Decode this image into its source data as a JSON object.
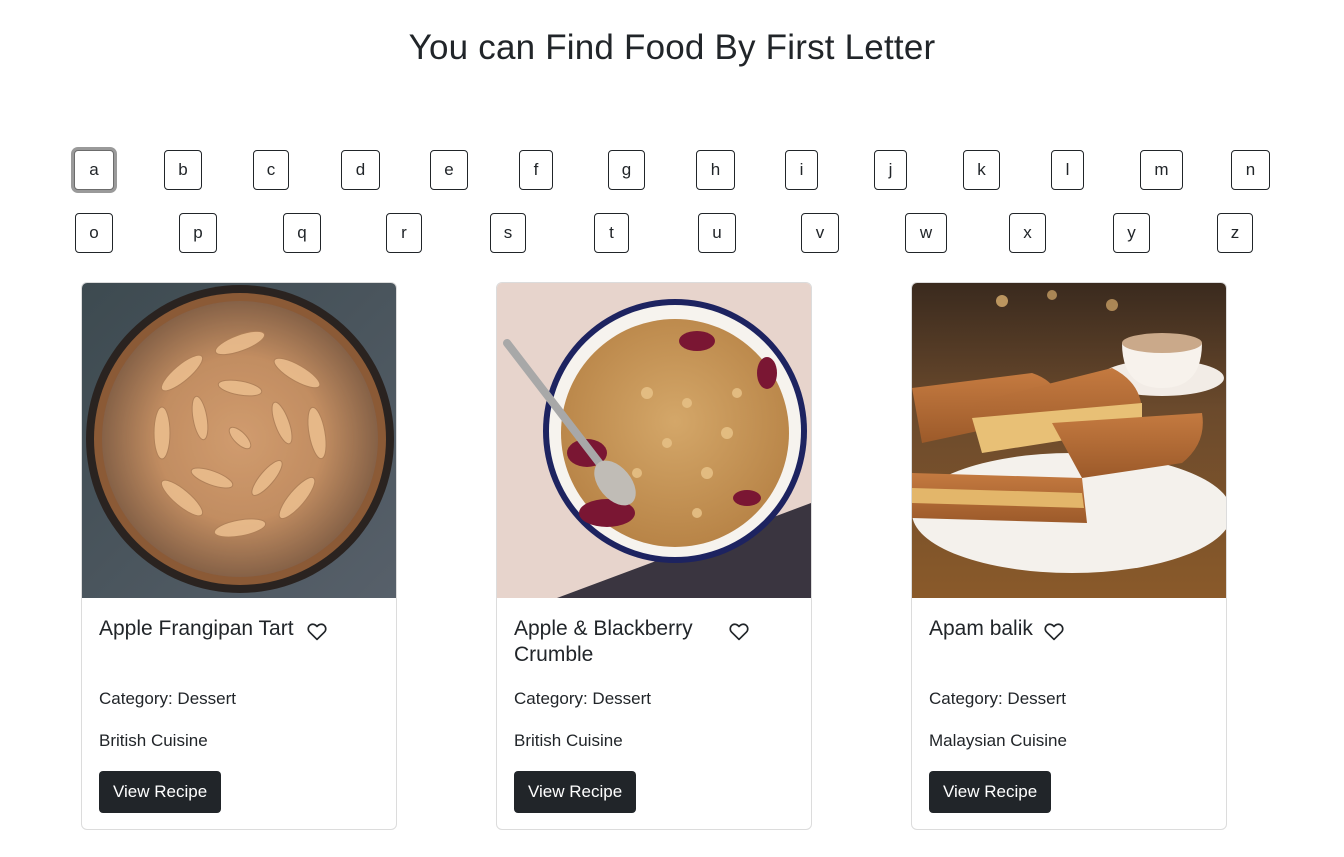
{
  "page": {
    "title": "You can Find Food By First Letter"
  },
  "letters": {
    "row1": [
      "a",
      "b",
      "c",
      "d",
      "e",
      "f",
      "g",
      "h",
      "i",
      "j",
      "k",
      "l",
      "m",
      "n"
    ],
    "row2": [
      "o",
      "p",
      "q",
      "r",
      "s",
      "t",
      "u",
      "v",
      "w",
      "x",
      "y",
      "z"
    ],
    "selected": "a"
  },
  "meals": [
    {
      "name": "Apple Frangipan Tart",
      "category": "Category: Dessert",
      "area": "British Cuisine",
      "button": "View Recipe",
      "image": "apple-frangipan-tart-photo",
      "favorite_icon": "heart-outline-icon"
    },
    {
      "name": "Apple & Blackberry Crumble",
      "category": "Category: Dessert",
      "area": "British Cuisine",
      "button": "View Recipe",
      "image": "apple-blackberry-crumble-photo",
      "favorite_icon": "heart-outline-icon"
    },
    {
      "name": "Apam balik",
      "category": "Category: Dessert",
      "area": "Malaysian Cuisine",
      "button": "View Recipe",
      "image": "apam-balik-photo",
      "favorite_icon": "heart-outline-icon"
    }
  ]
}
